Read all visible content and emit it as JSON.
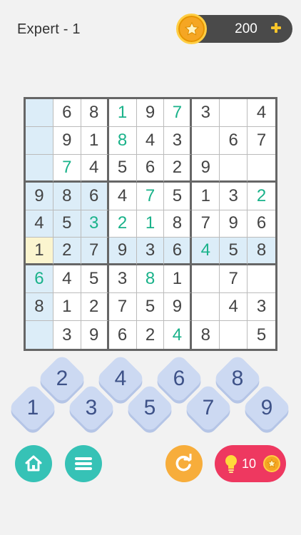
{
  "header": {
    "level_title": "Expert - 1",
    "coins": "200"
  },
  "board": {
    "rows": [
      [
        "",
        "6",
        "8",
        "1",
        "9",
        "7",
        "3",
        "",
        "4"
      ],
      [
        "",
        "9",
        "1",
        "8",
        "4",
        "3",
        "",
        "6",
        "7"
      ],
      [
        "",
        "7",
        "4",
        "5",
        "6",
        "2",
        "9",
        "",
        ""
      ],
      [
        "9",
        "8",
        "6",
        "4",
        "7",
        "5",
        "1",
        "3",
        "2"
      ],
      [
        "4",
        "5",
        "3",
        "2",
        "1",
        "8",
        "7",
        "9",
        "6"
      ],
      [
        "1",
        "2",
        "7",
        "9",
        "3",
        "6",
        "4",
        "5",
        "8"
      ],
      [
        "6",
        "4",
        "5",
        "3",
        "8",
        "1",
        "",
        "7",
        ""
      ],
      [
        "8",
        "1",
        "2",
        "7",
        "5",
        "9",
        "",
        "4",
        "3"
      ],
      [
        "",
        "3",
        "9",
        "6",
        "2",
        "4",
        "8",
        "",
        "5"
      ]
    ],
    "user_entered": [
      [
        0,
        3
      ],
      [
        0,
        5
      ],
      [
        1,
        3
      ],
      [
        2,
        1
      ],
      [
        3,
        4
      ],
      [
        3,
        8
      ],
      [
        4,
        2
      ],
      [
        4,
        3
      ],
      [
        4,
        4
      ],
      [
        5,
        6
      ],
      [
        6,
        0
      ],
      [
        6,
        4
      ],
      [
        8,
        5
      ]
    ],
    "selected": [
      5,
      0
    ],
    "highlighted_row": 5,
    "highlighted_col": 0,
    "highlighted_box": [
      3,
      0
    ]
  },
  "pad": {
    "keys": [
      "1",
      "2",
      "3",
      "4",
      "5",
      "6",
      "7",
      "8",
      "9"
    ]
  },
  "controls": {
    "hint_count": "10"
  },
  "colors": {
    "background": "#f2f2f2",
    "highlight": "#dcedf8",
    "selected": "#fbf5cf",
    "user_digit": "#1ab28a",
    "pad_key": "#ccd9f2",
    "pad_text": "#3e5288",
    "teal_button": "#36c2b6",
    "orange_button": "#f7ad3b",
    "hint_button": "#ee3860"
  }
}
